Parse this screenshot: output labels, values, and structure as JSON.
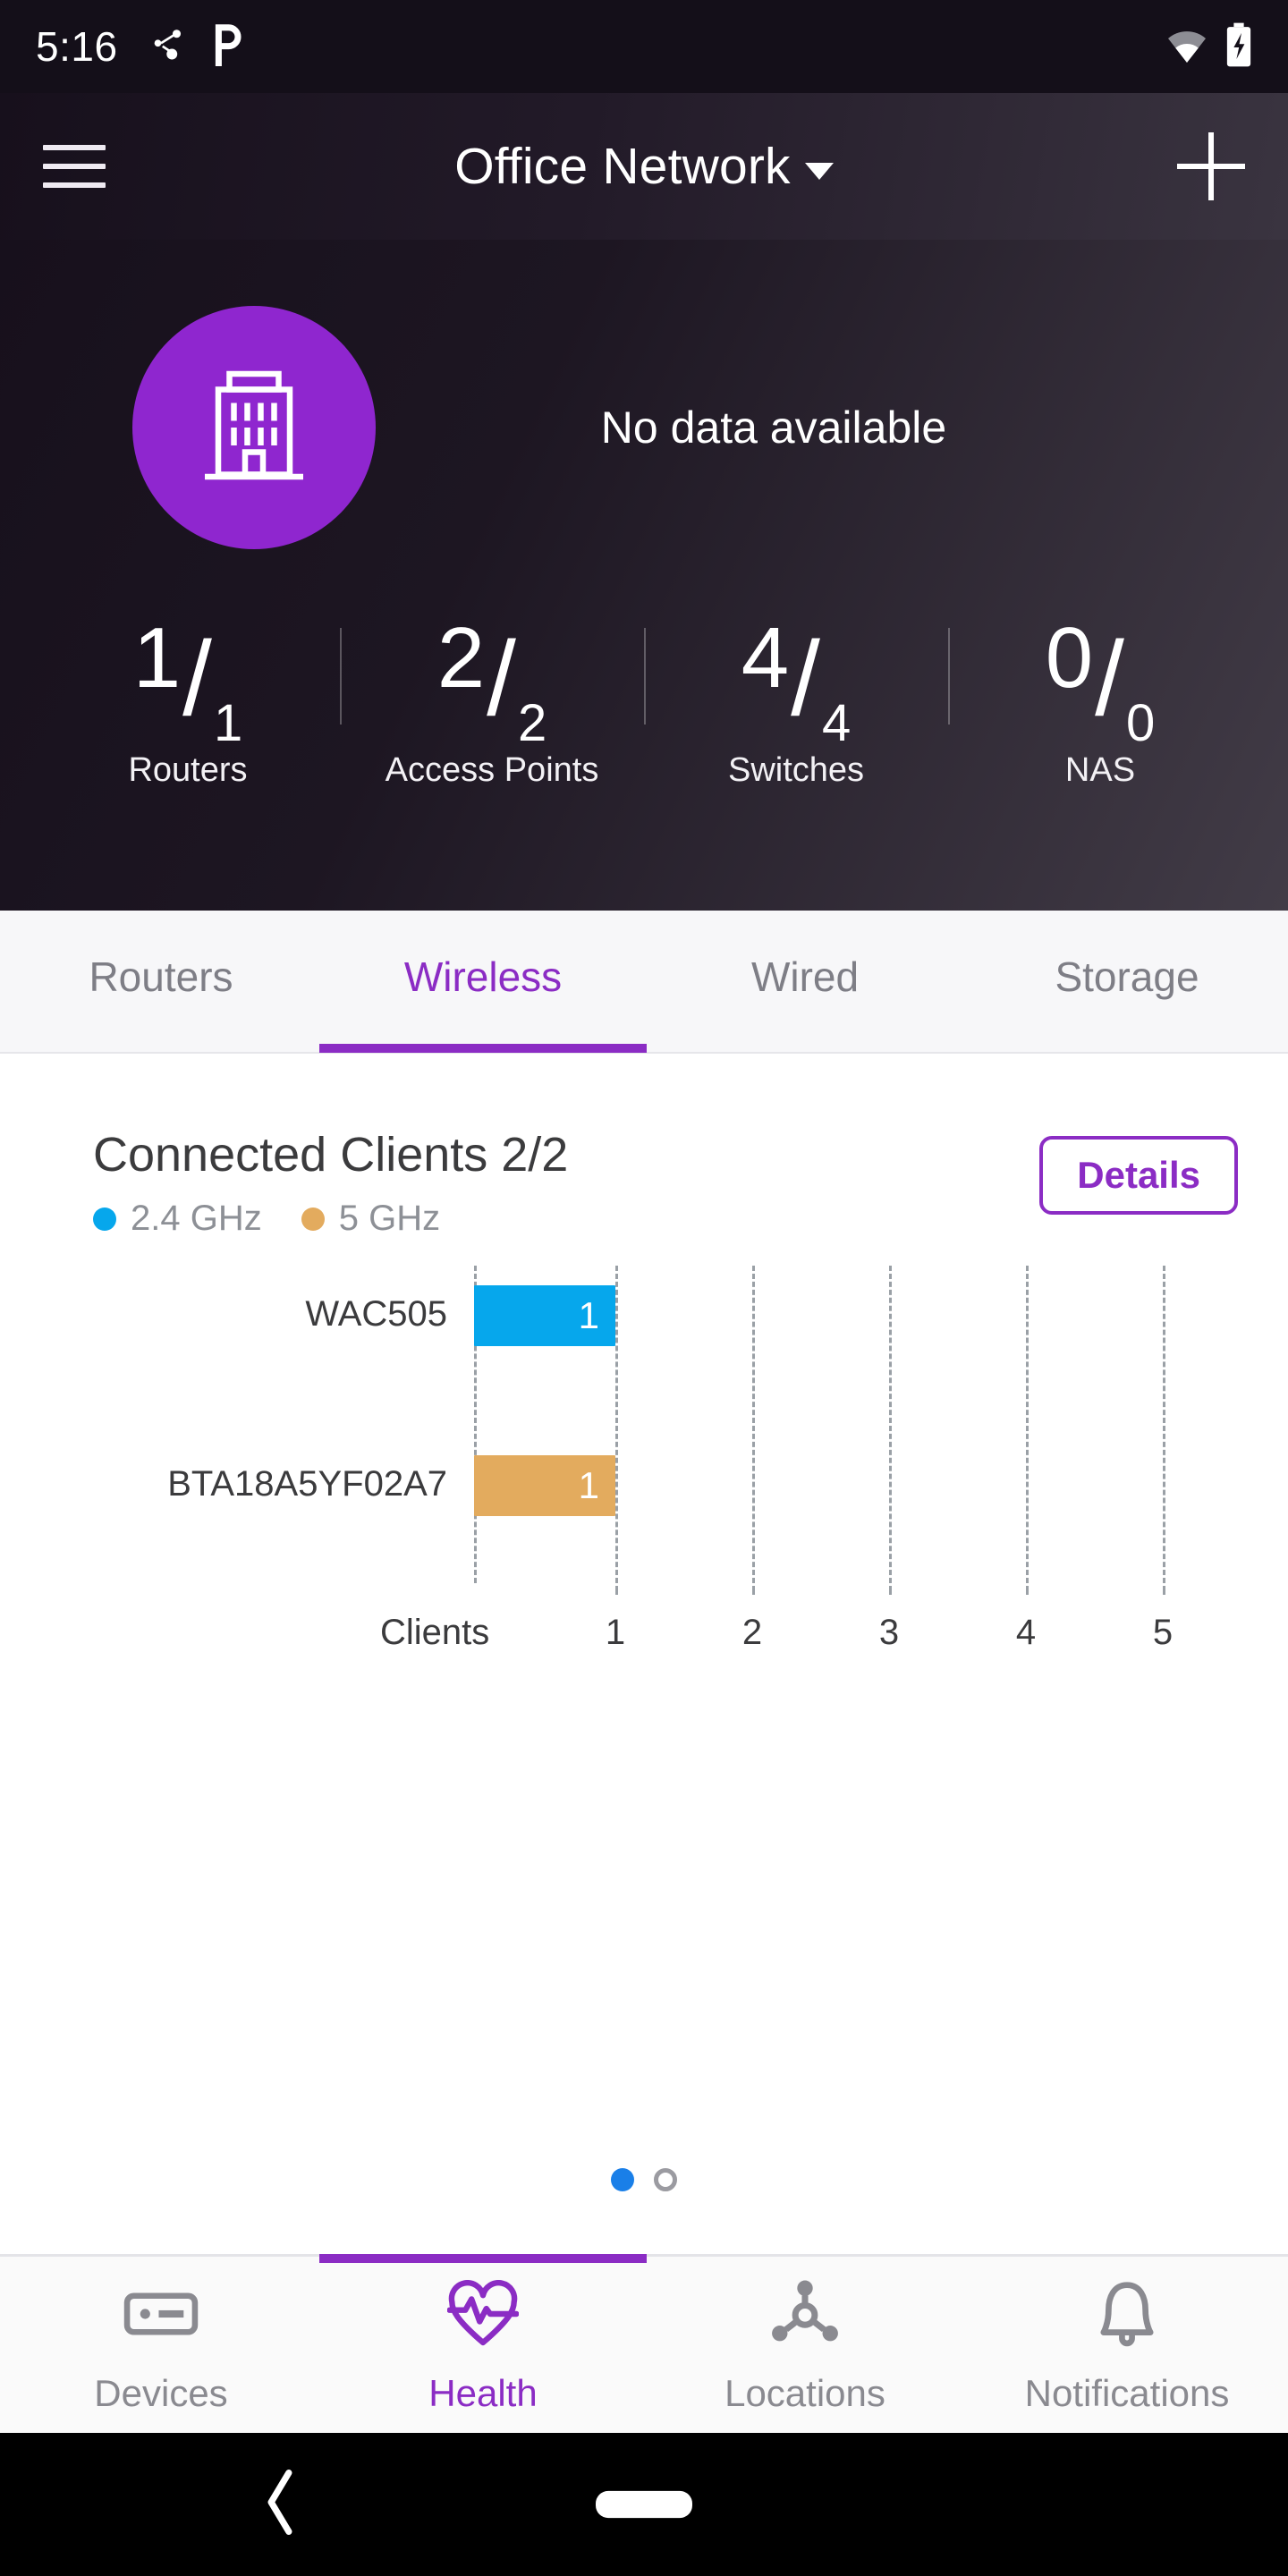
{
  "status_bar": {
    "time": "5:16",
    "icons_left": [
      "network-share-icon",
      "app-p-icon"
    ],
    "icons_right": [
      "wifi-icon",
      "battery-charging-icon"
    ]
  },
  "app_bar": {
    "menu_icon": "hamburger-menu-icon",
    "title": "Office Network",
    "dropdown_icon": "chevron-down-icon",
    "add_icon": "plus-icon"
  },
  "hero": {
    "avatar_icon": "office-building-icon",
    "avatar_color": "#8f26cf",
    "status_text": "No data available",
    "stats": [
      {
        "numerator": "1",
        "separator": "/",
        "denominator": "1",
        "label": "Routers"
      },
      {
        "numerator": "2",
        "separator": "/",
        "denominator": "2",
        "label": "Access Points"
      },
      {
        "numerator": "4",
        "separator": "/",
        "denominator": "4",
        "label": "Switches"
      },
      {
        "numerator": "0",
        "separator": "/",
        "denominator": "0",
        "label": "NAS"
      }
    ]
  },
  "tabs": {
    "active_index": 1,
    "items": [
      {
        "label": "Routers"
      },
      {
        "label": "Wireless"
      },
      {
        "label": "Wired"
      },
      {
        "label": "Storage"
      }
    ],
    "accent": "#8b2cc4"
  },
  "card": {
    "title": "Connected Clients 2/2",
    "details_label": "Details",
    "legend": [
      {
        "label": "2.4 GHz",
        "color": "#06a7ec"
      },
      {
        "label": "5 GHz",
        "color": "#e3ab5e"
      }
    ]
  },
  "chart_data": {
    "type": "bar",
    "orientation": "horizontal",
    "title": "Connected Clients 2/2",
    "xlabel": "Clients",
    "ylabel": "",
    "categories": [
      "WAC505",
      "BTA18A5YF02A7"
    ],
    "values": [
      1,
      1
    ],
    "bar_labels": [
      "1",
      "1"
    ],
    "colors": [
      "#06a7ec",
      "#e3ab5e"
    ],
    "series": [
      {
        "name": "2.4 GHz",
        "color": "#06a7ec",
        "categories": [
          "WAC505"
        ],
        "values": [
          1
        ]
      },
      {
        "name": "5 GHz",
        "color": "#e3ab5e",
        "categories": [
          "BTA18A5YF02A7"
        ],
        "values": [
          1
        ]
      }
    ],
    "xlim": [
      0,
      5
    ],
    "xticks": [
      "1",
      "2",
      "3",
      "4",
      "5"
    ],
    "grid": true,
    "grid_style": "dashed-vertical",
    "legend_position": "top-left"
  },
  "pager": {
    "total": 2,
    "active_index": 0,
    "active_color": "#1a7fe8"
  },
  "bottom_nav": {
    "active_index": 1,
    "items": [
      {
        "label": "Devices",
        "icon": "router-device-icon"
      },
      {
        "label": "Health",
        "icon": "heart-pulse-icon"
      },
      {
        "label": "Locations",
        "icon": "network-topology-icon"
      },
      {
        "label": "Notifications",
        "icon": "bell-icon"
      }
    ]
  },
  "system_nav": {
    "back_icon": "back-chevron-icon",
    "home_icon": "home-pill-icon"
  }
}
